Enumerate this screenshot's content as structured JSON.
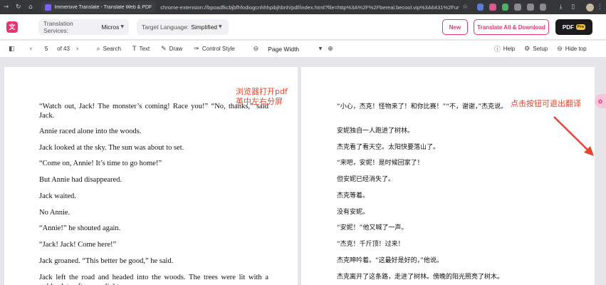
{
  "browser": {
    "tab_title": "Immersive Translate - Translate Web & PDF",
    "address": "chrome-extension://bpoadfkcbjbfhfodiogcnhhhpibjhbnh/pdf/index.html?file=http%3A%2F%2Fbereal.becool.vip%3A6431%2FunEn..."
  },
  "translate_bar": {
    "logo": "文",
    "service_label": "Translation Services:",
    "service_value": "Micros",
    "target_label": "Target Language:",
    "target_value": "Simplified",
    "new_label": "New",
    "translate_all_label": "Translate All & Download",
    "pdf_label": "PDF",
    "pro_badge": "Pro"
  },
  "viewer_bar": {
    "page_current": "5",
    "page_total": "of 43",
    "search_label": "Search",
    "text_label": "Text",
    "draw_label": "Draw",
    "control_style_label": "Control Style",
    "zoom_value": "Page Width",
    "help_label": "Help",
    "setup_label": "Setup",
    "hide_top_label": "Hide top"
  },
  "left_page": {
    "paragraphs": [
      "“Watch out, Jack! The monster’s coming! Race you!” “No, thanks,” said Jack.",
      "Annie raced alone into the woods.",
      "Jack looked at the sky. The sun was about to set.",
      "“Come on, Annie! It’s time to go home!”",
      "But Annie had disappeared.",
      "Jack waited.",
      "No Annie.",
      "“Annie!” he shouted again.",
      "“Jack! Jack! Come here!”",
      "Jack groaned. “This better be good,” he said.",
      "Jack left the road and headed into the woods. The trees were lit with a golden late-afternoon light."
    ]
  },
  "right_page": {
    "paragraphs": [
      "“小心，杰克！怪物来了！和你比赛！”“不，谢谢，”杰克说。",
      "安妮独自一人跑进了树林。",
      "杰克看了看天空。太阳快要落山了。",
      "“来吧，安妮！是时候回家了！",
      "但安妮已经消失了。",
      "杰克等着。",
      "没有安妮。",
      "“安妮！”他又喊了一声。",
      "“杰克！千斤顶！过来！",
      "杰克呻吟着。“这最好是好的，”他说。",
      "杰克离开了这条路，走进了树林。傍晚的阳光照亮了树木。"
    ]
  },
  "annotations": {
    "left_line1": "浏览器打开pdf",
    "left_line2": "英中左右分屏",
    "right": "点击按钮可退出翻译"
  },
  "colors": {
    "brand": "#e4366f",
    "annotation": "#e8442e"
  }
}
